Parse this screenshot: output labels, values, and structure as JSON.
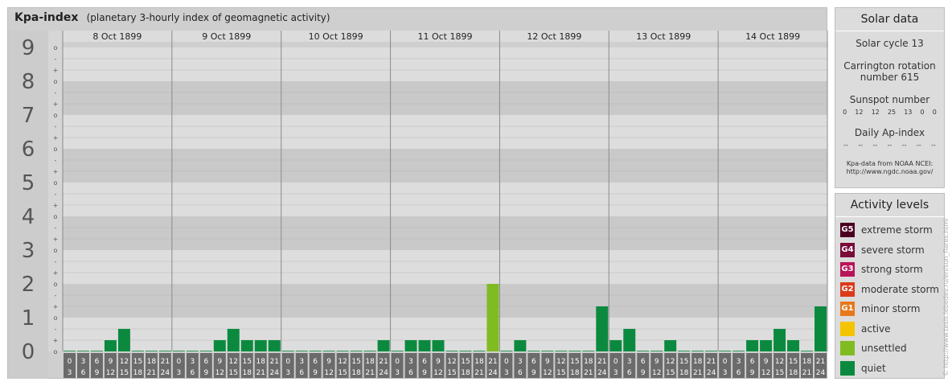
{
  "header": {
    "title": "Kpa-index",
    "subtitle": "(planetary 3-hourly index of geomagnetic activity)"
  },
  "chart_data": {
    "type": "bar",
    "ylim": [
      0,
      9
    ],
    "y_major_ticks": [
      "0",
      "1",
      "2",
      "3",
      "4",
      "5",
      "6",
      "7",
      "8",
      "9"
    ],
    "y_minor_ticks": [
      "o",
      "+",
      "-",
      "o",
      "+",
      "-",
      "o",
      "+",
      "-",
      "o",
      "+",
      "-",
      "o",
      "+",
      "-",
      "o",
      "+",
      "-",
      "o",
      "+",
      "-",
      "o",
      "+",
      "-",
      "o",
      "+",
      "-",
      "o"
    ],
    "days": [
      "8 Oct 1899",
      "9 Oct 1899",
      "10 Oct 1899",
      "11 Oct 1899",
      "12 Oct 1899",
      "13 Oct 1899",
      "14 Oct 1899"
    ],
    "interval_labels": [
      [
        "0",
        "3"
      ],
      [
        "3",
        "6"
      ],
      [
        "6",
        "9"
      ],
      [
        "9",
        "12"
      ],
      [
        "12",
        "15"
      ],
      [
        "15",
        "18"
      ],
      [
        "18",
        "21"
      ],
      [
        "21",
        "24"
      ]
    ],
    "values": [
      [
        0,
        0,
        0,
        0.333,
        0.667,
        0,
        0,
        0
      ],
      [
        0,
        0,
        0,
        0.333,
        0.667,
        0.333,
        0.333,
        0.333
      ],
      [
        0,
        0,
        0,
        0,
        0,
        0,
        0,
        0.333
      ],
      [
        0,
        0.333,
        0.333,
        0.333,
        0,
        0,
        0,
        2
      ],
      [
        0,
        0.333,
        0,
        0,
        0,
        0,
        0,
        1.333
      ],
      [
        0.333,
        0.667,
        0,
        0,
        0.333,
        0,
        0,
        0
      ],
      [
        0,
        0,
        0.333,
        0.333,
        0.667,
        0.333,
        0,
        1.333
      ]
    ],
    "levels": [
      [
        0,
        0,
        0,
        0,
        0,
        0,
        0,
        0
      ],
      [
        0,
        0,
        0,
        0,
        0,
        0,
        0,
        0
      ],
      [
        0,
        0,
        0,
        0,
        0,
        0,
        0,
        0
      ],
      [
        0,
        0,
        0,
        0,
        0,
        0,
        0,
        "unsettled"
      ],
      [
        0,
        0,
        0,
        0,
        0,
        0,
        0,
        0
      ],
      [
        0,
        0,
        0,
        0,
        0,
        0,
        0,
        0
      ],
      [
        0,
        0,
        0,
        0,
        0,
        0,
        0,
        0
      ]
    ],
    "colors": {
      "quiet": "#0b8a3f",
      "unsettled": "#80bb22",
      "band_dark": "#c9c9c9",
      "band_light": "#dddddd",
      "label_box": "#6b6b6b"
    }
  },
  "solar": {
    "title": "Solar data",
    "cycle": "Solar cycle 13",
    "carrington_1": "Carrington rotation",
    "carrington_2": "number 615",
    "sunspot_title": "Sunspot number",
    "sunspots": [
      "0",
      "12",
      "12",
      "25",
      "13",
      "0",
      "0"
    ],
    "ap_title": "Daily Ap-index",
    "ap_values": [
      "--",
      "--",
      "--",
      "--",
      "--",
      "--",
      "--"
    ],
    "source_1": "Kpa-data from NOAA NCEI:",
    "source_2": "http://www.ngdc.noaa.gov/"
  },
  "activity": {
    "title": "Activity levels",
    "levels": [
      {
        "code": "G5",
        "label": "extreme storm",
        "color": "#4a0020"
      },
      {
        "code": "G4",
        "label": "severe storm",
        "color": "#7a0a3a"
      },
      {
        "code": "G3",
        "label": "strong storm",
        "color": "#b8145a"
      },
      {
        "code": "G2",
        "label": "moderate storm",
        "color": "#dc3a1a"
      },
      {
        "code": "G1",
        "label": "minor storm",
        "color": "#e8781a"
      },
      {
        "code": "",
        "label": "active",
        "color": "#f4c400"
      },
      {
        "code": "",
        "label": "unsettled",
        "color": "#80bb22"
      },
      {
        "code": "",
        "label": "quiet",
        "color": "#0b8a3f"
      }
    ]
  },
  "watermark": "© http://www.tesis.lebedev.ru/en/sun_flares.html"
}
